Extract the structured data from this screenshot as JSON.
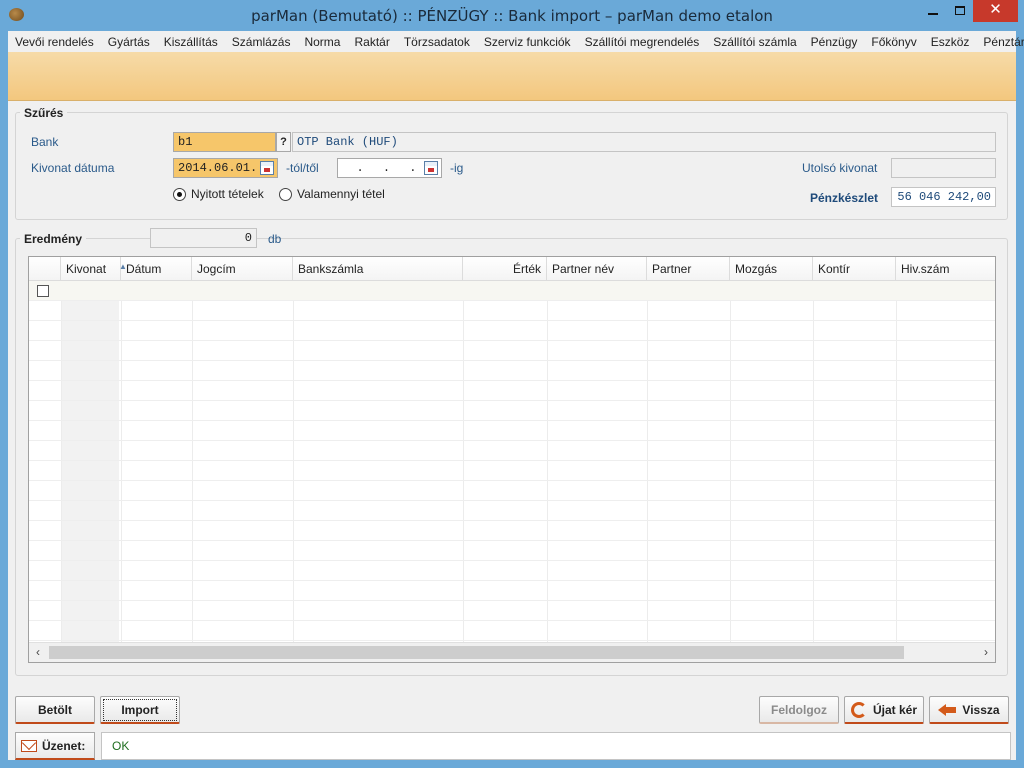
{
  "window": {
    "title": "parMan (Bemutató) :: PÉNZÜGY :: Bank import   –   parMan demo etalon"
  },
  "menu": [
    "Vevői rendelés",
    "Gyártás",
    "Kiszállítás",
    "Számlázás",
    "Norma",
    "Raktár",
    "Törzsadatok",
    "Szerviz funkciók",
    "Szállítói megrendelés",
    "Szállítói számla",
    "Pénzügy",
    "Főkönyv",
    "Eszköz",
    "Pénztár"
  ],
  "filter": {
    "title": "Szűrés",
    "bank_label": "Bank",
    "bank_code": "b1",
    "bank_lookup_label": "?",
    "bank_name": "OTP Bank (HUF)",
    "date_label": "Kivonat dátuma",
    "date_from": "2014.06.01.",
    "date_from_suffix": "-tól/től",
    "date_to": "  .  .  .",
    "date_to_suffix": "-ig",
    "last_statement_label": "Utolsó kivonat",
    "last_statement_value": "",
    "balance_label": "Pénzkészlet",
    "balance_value": "56 046 242,00",
    "radio_open": "Nyitott tételek",
    "radio_all": "Valamennyi tétel",
    "radio_selected": "open"
  },
  "result": {
    "title": "Eredmény",
    "count": "0",
    "count_unit": "db",
    "columns": [
      "Kivonat",
      "Dátum",
      "Jogcím",
      "Bankszámla",
      "Érték",
      "Partner név",
      "Partner",
      "Mozgás",
      "Kontír",
      "Hiv.szám"
    ],
    "rows": []
  },
  "buttons": {
    "load": "Betölt",
    "import": "Import",
    "process": "Feldolgoz",
    "refresh": "Újat kér",
    "back": "Vissza"
  },
  "status": {
    "label": "Üzenet:",
    "message": "OK"
  }
}
